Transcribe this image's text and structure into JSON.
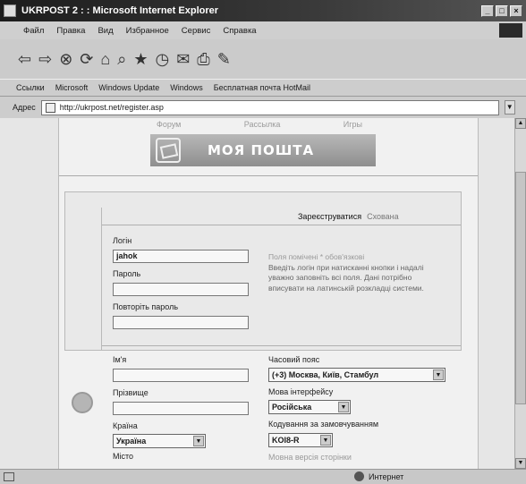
{
  "window": {
    "title": "UKRPOST 2 : : Microsoft Internet Explorer",
    "buttons": [
      "_",
      "□",
      "×"
    ]
  },
  "menu": {
    "items": [
      "Файл",
      "Правка",
      "Вид",
      "Избранное",
      "Сервис",
      "Справка"
    ]
  },
  "toolbar": {
    "icons": [
      "back-icon",
      "forward-icon",
      "stop-icon",
      "refresh-icon",
      "home-icon",
      "search-icon",
      "favorites-icon",
      "history-icon",
      "mail-icon",
      "print-icon",
      "edit-icon"
    ],
    "glyphs": [
      "⇦",
      "⇨",
      "⊗",
      "⟳",
      "⌂",
      "⌕",
      "★",
      "◷",
      "✉",
      "⎙",
      "✎"
    ]
  },
  "links": {
    "label": "Ссылки",
    "items": [
      "Microsoft",
      "Windows Update",
      "Windows",
      "Бесплатная почта HotMail"
    ]
  },
  "address": {
    "label": "Адрес",
    "url": "http://ukrpost.net/register.asp"
  },
  "page": {
    "nav": [
      "Форум",
      "Рассылка",
      "Игры"
    ],
    "banner_title": "МОЯ ПОШТА",
    "tabs": {
      "active": "Зареєструватися",
      "inactive": "Схована"
    },
    "fields": {
      "login_label": "Логін",
      "login_value": "jahok",
      "password_label": "Пароль",
      "password_repeat_label": "Повторіть пароль",
      "name_label": "Ім'я",
      "surname_label": "Прізвище",
      "country_label": "Країна",
      "country_value": "Україна",
      "city_label": "Місто"
    },
    "hint": {
      "head": "Поля помічені * обов'язкові",
      "text": "Введіть логін при натисканні кнопки і надалі уважно заповніть всі поля. Дані потрібно вписувати на латинській розкладці системи."
    },
    "right": {
      "timezone_label": "Часовий пояс",
      "timezone_value": "(+3) Москва, Київ, Стамбул",
      "language_label": "Мова інтерфейсу",
      "language_value": "Російська",
      "encoding_label": "Кодування за замовчуванням",
      "encoding_value": "KOI8-R",
      "extra_label": "Мовна версія сторінки"
    }
  },
  "status": {
    "zone": "Интернет"
  }
}
